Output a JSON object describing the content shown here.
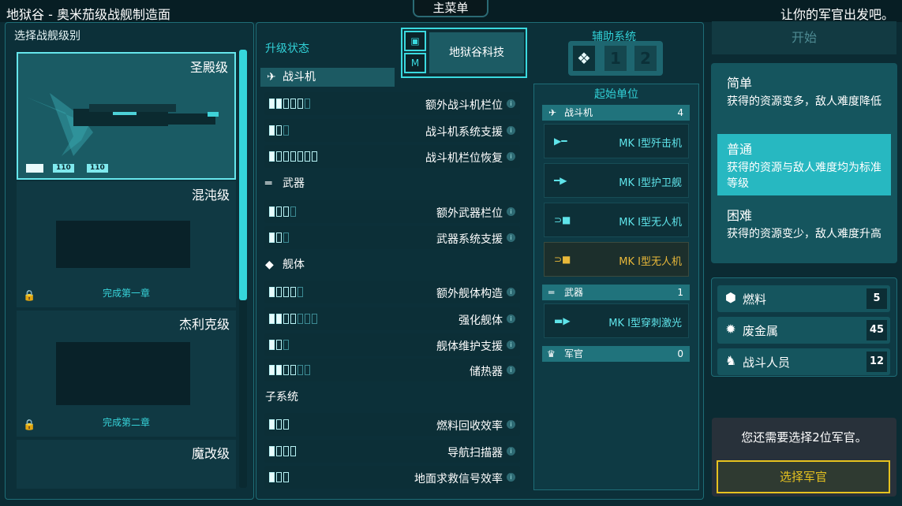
{
  "header": {
    "title": "地狱谷 - 奥米茄级战舰制造面",
    "main_menu": "主菜单",
    "tagline": "让你的军官出发吧。"
  },
  "ship_select": {
    "label": "选择战舰级别",
    "ships": [
      {
        "name": "圣殿级",
        "selected": true,
        "badge1": "110",
        "badge2": "110"
      },
      {
        "name": "混沌级",
        "locked": true,
        "hint": "完成第一章"
      },
      {
        "name": "杰利克级",
        "locked": true,
        "hint": "完成第二章"
      },
      {
        "name": "魔改级"
      }
    ]
  },
  "upgrades": {
    "label": "升级状态",
    "groups": [
      {
        "name": "战斗机",
        "rows": [
          {
            "label": "额外战斗机栏位",
            "on": 2,
            "off": 3,
            "dim": 1
          },
          {
            "label": "战斗机系统支援",
            "on": 1,
            "off": 1,
            "dim": 1
          },
          {
            "label": "战斗机栏位恢复",
            "on": 1,
            "off": 6,
            "dim": 0
          }
        ]
      },
      {
        "name": "武器",
        "rows": [
          {
            "label": "额外武器栏位",
            "on": 1,
            "off": 2,
            "dim": 1
          },
          {
            "label": "武器系统支援",
            "on": 1,
            "off": 1,
            "dim": 1
          }
        ]
      },
      {
        "name": "舰体",
        "rows": [
          {
            "label": "额外舰体构造",
            "on": 1,
            "off": 3,
            "dim": 1
          },
          {
            "label": "强化舰体",
            "on": 2,
            "off": 2,
            "dim": 3
          },
          {
            "label": "舰体维护支援",
            "on": 1,
            "off": 1,
            "dim": 1
          },
          {
            "label": "储热器",
            "on": 2,
            "off": 2,
            "dim": 2
          }
        ]
      },
      {
        "name": "子系统",
        "rows": [
          {
            "label": "燃料回收效率",
            "on": 1,
            "off": 2,
            "dim": 0
          },
          {
            "label": "导航扫描器",
            "on": 1,
            "off": 3,
            "dim": 0
          },
          {
            "label": "地面求救信号效率",
            "on": 1,
            "off": 2,
            "dim": 0
          }
        ]
      }
    ]
  },
  "augment": {
    "name": "地狱谷科技"
  },
  "aux_systems": {
    "label": "辅助系统",
    "slot1": "1",
    "slot2": "2"
  },
  "starting_units": {
    "label": "起始单位",
    "fighters": {
      "label": "战斗机",
      "count": "4",
      "units": [
        "MK I型歼击机",
        "MK I型护卫舰",
        "MK I型无人机",
        "MK I型无人机"
      ]
    },
    "weapons": {
      "label": "武器",
      "count": "1",
      "units": [
        "MK I型穿刺激光"
      ]
    },
    "officers": {
      "label": "军官",
      "count": "0"
    }
  },
  "start_button": "开始",
  "difficulty": [
    {
      "title": "简单",
      "desc": "获得的资源变多，敌人难度降低"
    },
    {
      "title": "普通",
      "desc": "获得的资源与敌人难度均为标准等级",
      "selected": true
    },
    {
      "title": "困难",
      "desc": "获得的资源变少，敌人难度升高"
    }
  ],
  "resources": [
    {
      "name": "燃料",
      "value": "5",
      "icon": "fuel-icon"
    },
    {
      "name": "废金属",
      "value": "45",
      "icon": "scrap-icon"
    },
    {
      "name": "战斗人员",
      "value": "12",
      "icon": "crew-icon"
    }
  ],
  "officer_panel": {
    "message": "您还需要选择2位军官。",
    "button": "选择军官"
  },
  "colors": {
    "accent": "#35d6dc",
    "gold": "#e6c21f",
    "background": "#0b2b33"
  }
}
